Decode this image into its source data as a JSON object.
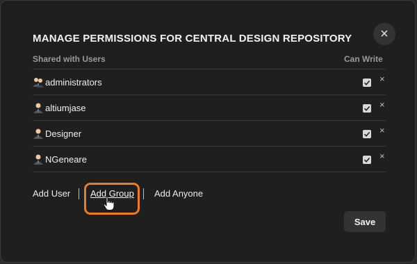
{
  "dialog": {
    "title": "MANAGE PERMISSIONS FOR CENTRAL DESIGN REPOSITORY",
    "close_label": "×"
  },
  "table": {
    "headers": {
      "users": "Shared with Users",
      "can_write": "Can Write"
    },
    "rows": [
      {
        "name": "administrators",
        "icon": "group-icon",
        "can_write": true,
        "remove_label": "×"
      },
      {
        "name": "altiumjase",
        "icon": "user-icon",
        "can_write": true,
        "remove_label": "×"
      },
      {
        "name": "Designer",
        "icon": "user-icon",
        "can_write": true,
        "remove_label": "×"
      },
      {
        "name": "NGeneare",
        "icon": "user-icon",
        "can_write": true,
        "remove_label": "×"
      }
    ]
  },
  "actions": {
    "add_user": "Add User",
    "add_group": "Add Group",
    "add_anyone": "Add Anyone"
  },
  "footer": {
    "save_label": "Save"
  },
  "colors": {
    "highlight": "#ef7a1f",
    "background": "#1f1f1f"
  }
}
